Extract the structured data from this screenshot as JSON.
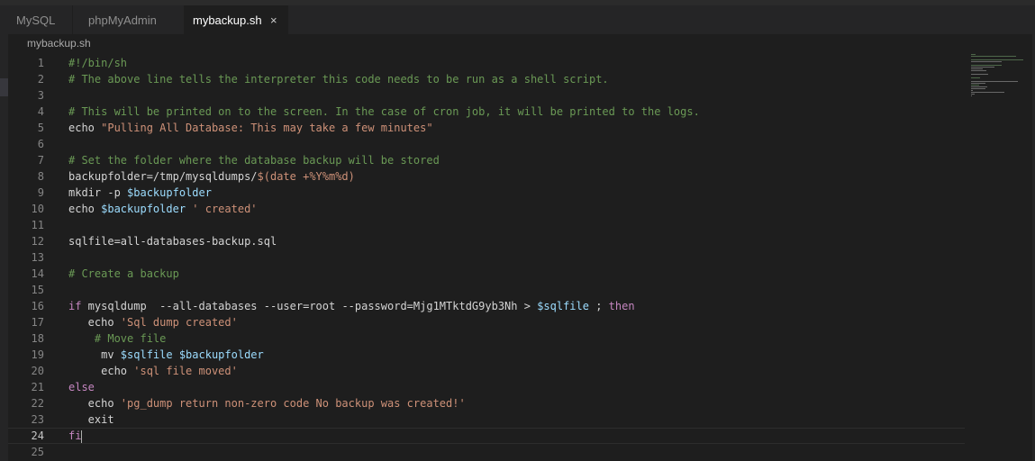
{
  "tabs": [
    {
      "label": "MySQL"
    },
    {
      "label": "phpMyAdmin"
    },
    {
      "label": "mybackup.sh",
      "close": "×"
    }
  ],
  "breadcrumb": "mybackup.sh",
  "lines": [
    {
      "n": "1",
      "tokens": [
        {
          "t": "#!/bin/sh",
          "c": "c"
        }
      ]
    },
    {
      "n": "2",
      "tokens": [
        {
          "t": "# The above line tells the interpreter this code needs to be run as a shell script.",
          "c": "c"
        }
      ]
    },
    {
      "n": "3",
      "tokens": []
    },
    {
      "n": "4",
      "tokens": [
        {
          "t": "# This will be printed on to the screen. In the case of cron job, it will be printed to the logs.",
          "c": "c"
        }
      ]
    },
    {
      "n": "5",
      "tokens": [
        {
          "t": "echo ",
          "c": "p"
        },
        {
          "t": "\"Pulling All Database: This may take a few minutes\"",
          "c": "s"
        }
      ]
    },
    {
      "n": "6",
      "tokens": []
    },
    {
      "n": "7",
      "tokens": [
        {
          "t": "# Set the folder where the database backup will be stored",
          "c": "c"
        }
      ]
    },
    {
      "n": "8",
      "tokens": [
        {
          "t": "backupfolder=/tmp/mysqldumps/",
          "c": "p"
        },
        {
          "t": "$(date +%Y%m%d)",
          "c": "s"
        }
      ]
    },
    {
      "n": "9",
      "tokens": [
        {
          "t": "mkdir -p ",
          "c": "p"
        },
        {
          "t": "$backupfolder",
          "c": "v"
        }
      ]
    },
    {
      "n": "10",
      "tokens": [
        {
          "t": "echo ",
          "c": "p"
        },
        {
          "t": "$backupfolder",
          "c": "v"
        },
        {
          "t": " ",
          "c": "p"
        },
        {
          "t": "' created'",
          "c": "s"
        }
      ]
    },
    {
      "n": "11",
      "tokens": []
    },
    {
      "n": "12",
      "tokens": [
        {
          "t": "sqlfile=all-databases-backup.sql",
          "c": "p"
        }
      ]
    },
    {
      "n": "13",
      "tokens": []
    },
    {
      "n": "14",
      "tokens": [
        {
          "t": "# Create a backup",
          "c": "c"
        }
      ]
    },
    {
      "n": "15",
      "tokens": []
    },
    {
      "n": "16",
      "tokens": [
        {
          "t": "if",
          "c": "k"
        },
        {
          "t": " mysqldump  --all-databases --user=root --password=Mjg1MTktdG9yb3Nh > ",
          "c": "p"
        },
        {
          "t": "$sqlfile",
          "c": "v"
        },
        {
          "t": " ; ",
          "c": "p"
        },
        {
          "t": "then",
          "c": "k"
        }
      ]
    },
    {
      "n": "17",
      "tokens": [
        {
          "t": "   echo ",
          "c": "p"
        },
        {
          "t": "'Sql dump created'",
          "c": "s"
        }
      ]
    },
    {
      "n": "18",
      "tokens": [
        {
          "t": "    # Move file",
          "c": "c"
        }
      ]
    },
    {
      "n": "19",
      "tokens": [
        {
          "t": "     mv ",
          "c": "p"
        },
        {
          "t": "$sqlfile",
          "c": "v"
        },
        {
          "t": " ",
          "c": "p"
        },
        {
          "t": "$backupfolder",
          "c": "v"
        }
      ]
    },
    {
      "n": "20",
      "tokens": [
        {
          "t": "     echo ",
          "c": "p"
        },
        {
          "t": "'sql file moved'",
          "c": "s"
        }
      ]
    },
    {
      "n": "21",
      "tokens": [
        {
          "t": "else",
          "c": "k"
        }
      ]
    },
    {
      "n": "22",
      "tokens": [
        {
          "t": "   echo ",
          "c": "p"
        },
        {
          "t": "'pg_dump return non-zero code No backup was created!'",
          "c": "s"
        }
      ]
    },
    {
      "n": "23",
      "tokens": [
        {
          "t": "   exit",
          "c": "p"
        }
      ]
    },
    {
      "n": "24",
      "tokens": [
        {
          "t": "fi",
          "c": "k"
        }
      ],
      "current": true
    },
    {
      "n": "25",
      "tokens": []
    }
  ],
  "colors": {
    "comment": "#6a9955",
    "string": "#ce9178",
    "variable": "#9cdcfe",
    "keyword": "#c586c0",
    "background": "#1e1e1e"
  }
}
